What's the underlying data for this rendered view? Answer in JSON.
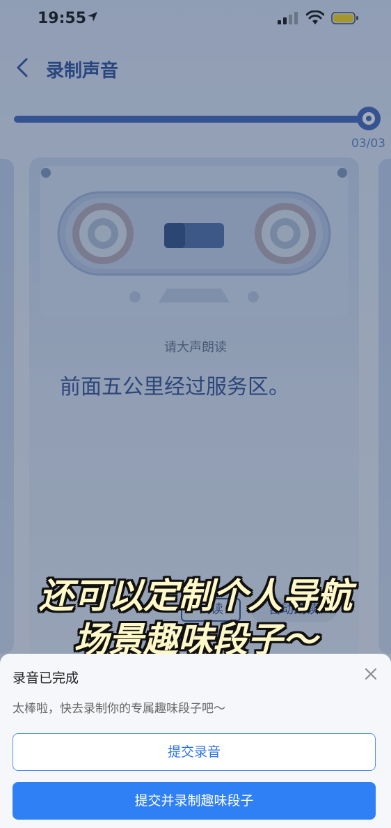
{
  "status_bar": {
    "time": "19:55"
  },
  "header": {
    "title": "录制声音"
  },
  "progress": {
    "counter": "03/03",
    "fraction": 1.0
  },
  "card": {
    "prompt": "请大声朗读",
    "sentence": "前面五公里经过服务区。",
    "read_button": "试读",
    "auto_button": "自动朗读"
  },
  "caption": {
    "line1": "还可以定制个人导航",
    "line2": "场景趣味段子～"
  },
  "sheet": {
    "title": "录音已完成",
    "description": "太棒啦，快去录制你的专属趣味段子吧～",
    "submit_label": "提交录音",
    "submit_record_label": "提交并录制趣味段子"
  },
  "colors": {
    "accent": "#2f80f4",
    "title_blue": "#2a4f9a",
    "battery": "#ffd60a"
  }
}
